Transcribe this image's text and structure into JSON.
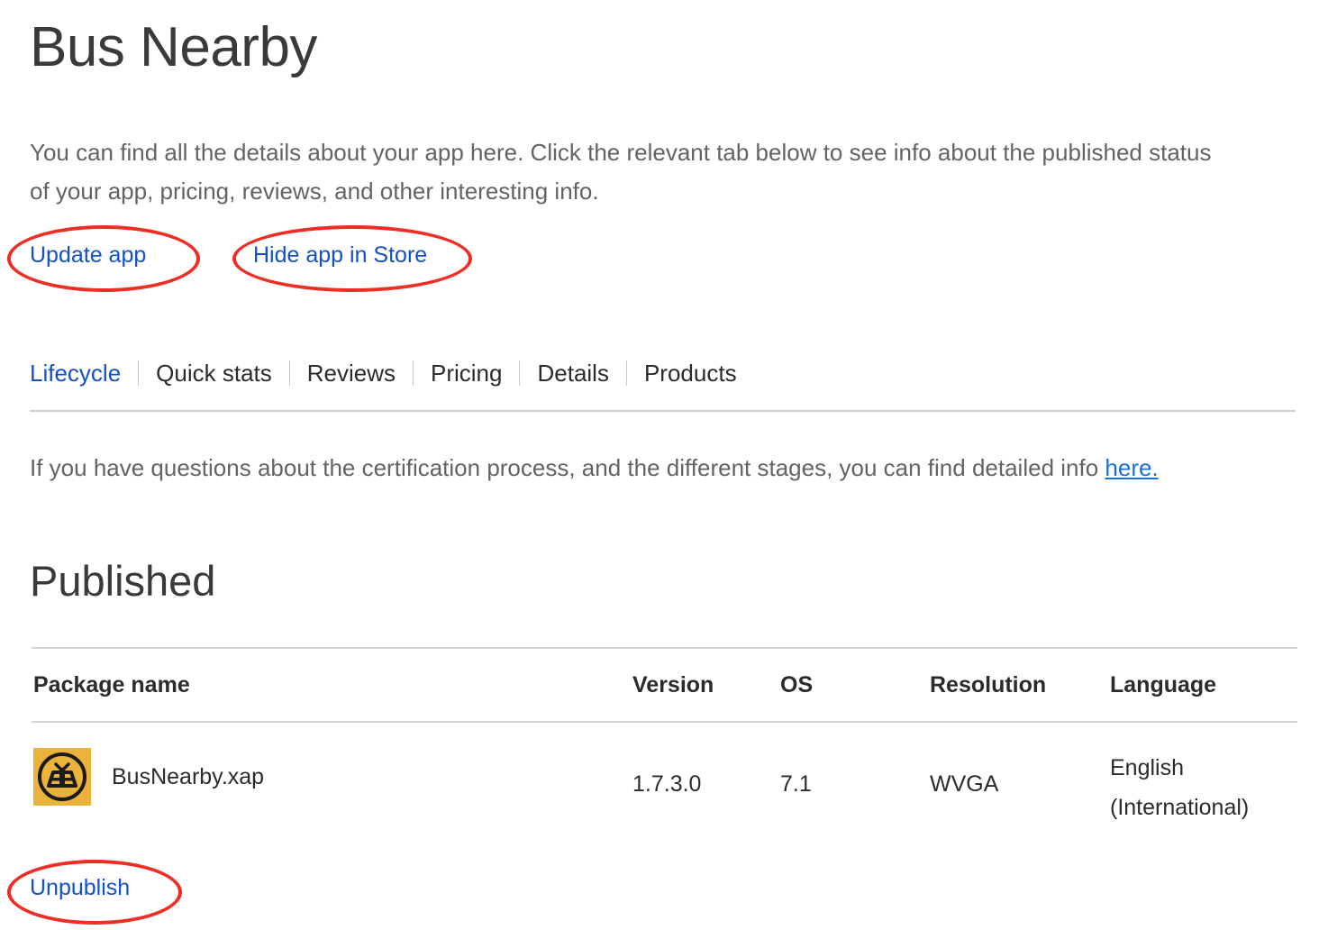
{
  "page": {
    "title": "Bus Nearby",
    "intro": "You can find all the details about your app here. Click the relevant tab below to see info about the published status of your app, pricing, reviews, and other interesting info."
  },
  "actions": {
    "update_label": "Update app",
    "hide_label": "Hide app in Store"
  },
  "tabs": [
    {
      "label": "Lifecycle",
      "active": true
    },
    {
      "label": "Quick stats",
      "active": false
    },
    {
      "label": "Reviews",
      "active": false
    },
    {
      "label": "Pricing",
      "active": false
    },
    {
      "label": "Details",
      "active": false
    },
    {
      "label": "Products",
      "active": false
    }
  ],
  "cert_info": {
    "text": "If you have questions about the certification process, and the different stages, you can find detailed info ",
    "link_label": "here."
  },
  "published": {
    "heading": "Published",
    "columns": {
      "package_name": "Package name",
      "version": "Version",
      "os": "OS",
      "resolution": "Resolution",
      "language": "Language"
    },
    "rows": [
      {
        "icon": "bus-app-icon",
        "package_name": "BusNearby.xap",
        "version": "1.7.3.0",
        "os": "7.1",
        "resolution": "WVGA",
        "language": "English (International)"
      }
    ],
    "unpublish_label": "Unpublish"
  },
  "annotations": {
    "highlight_color": "#ee2d24",
    "targets": [
      "Update app",
      "Hide app in Store",
      "Unpublish"
    ]
  },
  "colors": {
    "link": "#1450c8",
    "link_underlined": "#1f6fd0",
    "body_text": "#636363",
    "heading": "#3a3a3a",
    "icon_background": "#e9b33c",
    "rule": "#d2d2d2"
  }
}
